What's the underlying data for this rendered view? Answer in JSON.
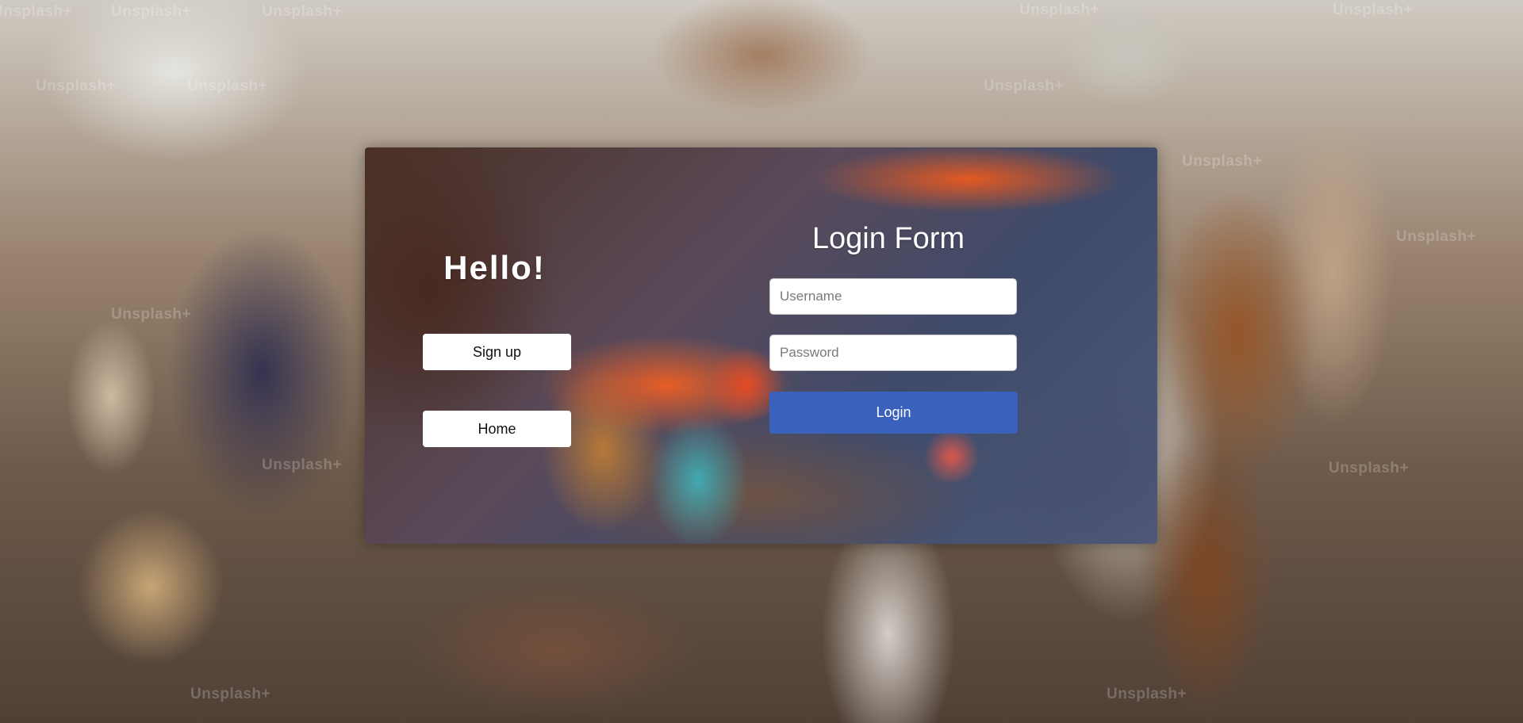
{
  "background": {
    "watermark_text": "Unsplash+"
  },
  "card": {
    "greeting": "Hello!",
    "signup_label": "Sign up",
    "home_label": "Home"
  },
  "login_form": {
    "title": "Login Form",
    "username_placeholder": "Username",
    "password_placeholder": "Password",
    "username_value": "",
    "password_value": "",
    "submit_label": "Login"
  },
  "colors": {
    "login_button": "#3a62bd",
    "side_button_bg": "#ffffff",
    "heading_text": "#ffffff"
  }
}
